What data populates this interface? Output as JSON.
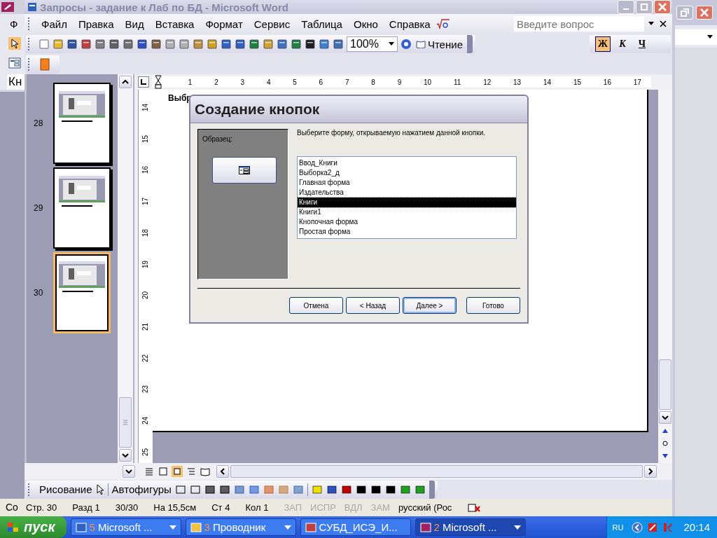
{
  "word_window": {
    "title": "Запросы - задание к Лаб по БД - Microsoft Word"
  },
  "background_window": {
    "menu_letter": "Ф",
    "field_text": "Кн",
    "status_text": "Со"
  },
  "menu": [
    {
      "label": "Файл"
    },
    {
      "label": "Правка"
    },
    {
      "label": "Вид"
    },
    {
      "label": "Вставка"
    },
    {
      "label": "Формат"
    },
    {
      "label": "Сервис"
    },
    {
      "label": "Таблица"
    },
    {
      "label": "Окно"
    },
    {
      "label": "Справка"
    }
  ],
  "help_box": {
    "placeholder": "Введите вопрос"
  },
  "toolbar": {
    "zoom": "100%",
    "reading": "Чтение",
    "format_buttons": [
      {
        "label": "Ж",
        "selected": true
      },
      {
        "label": "К",
        "selected": false
      },
      {
        "label": "Ч",
        "selected": false
      }
    ]
  },
  "thumbnails": [
    {
      "page": "28",
      "selected": false
    },
    {
      "page": "29",
      "selected": false
    },
    {
      "page": "30",
      "selected": true
    }
  ],
  "ruler": {
    "horizontal": [
      "1",
      "2",
      "3",
      "4",
      "5",
      "6",
      "7",
      "8",
      "9",
      "10",
      "11",
      "12",
      "13",
      "14",
      "15",
      "16",
      "17"
    ],
    "vertical": [
      "14",
      "15",
      "16",
      "17",
      "18",
      "19",
      "20",
      "21",
      "22",
      "23",
      "24",
      "25"
    ]
  },
  "document": {
    "text": "Выбр"
  },
  "dialog": {
    "title": "Создание кнопок",
    "sample_label": "Образец:",
    "instruction": "Выберите форму, открываемую нажатием данной кнопки.",
    "forms": [
      {
        "label": "Ввод_Книги",
        "selected": false
      },
      {
        "label": "Выборка2_д",
        "selected": false
      },
      {
        "label": "Главная форма",
        "selected": false
      },
      {
        "label": "Издательства",
        "selected": false
      },
      {
        "label": "Книги",
        "selected": true
      },
      {
        "label": "Книги1",
        "selected": false
      },
      {
        "label": "Кнопочная форма",
        "selected": false
      },
      {
        "label": "Простая форма",
        "selected": false
      }
    ],
    "buttons": [
      {
        "label": "Отмена",
        "default": false
      },
      {
        "label": "< Назад",
        "default": false
      },
      {
        "label": "Далее >",
        "default": true
      },
      {
        "label": "Готово",
        "default": false
      }
    ]
  },
  "drawing_toolbar": {
    "draw": "Рисование",
    "autoshapes": "Автофигуры"
  },
  "status_bar": {
    "fields": [
      "Стр. 30",
      "Разд 1",
      "30/30",
      "На 15,5см",
      "Ст 4",
      "Кол 1"
    ],
    "indicators": [
      {
        "label": "ЗАП",
        "on": false
      },
      {
        "label": "ИСПР",
        "on": false
      },
      {
        "label": "ВДЛ",
        "on": false
      },
      {
        "label": "ЗАМ",
        "on": false
      }
    ],
    "language": "русский (Рос"
  },
  "taskbar": {
    "start": "пуск",
    "tasks": [
      {
        "number": "5",
        "label": "Microsoft ...",
        "selected": false
      },
      {
        "number": "3",
        "label": "Проводник",
        "selected": false
      },
      {
        "label": "СУБД_ИСЭ_И...",
        "selected": false
      },
      {
        "number": "2",
        "label": "Microsoft ...",
        "selected": true
      }
    ],
    "language": "RU",
    "clock": "20:14"
  }
}
